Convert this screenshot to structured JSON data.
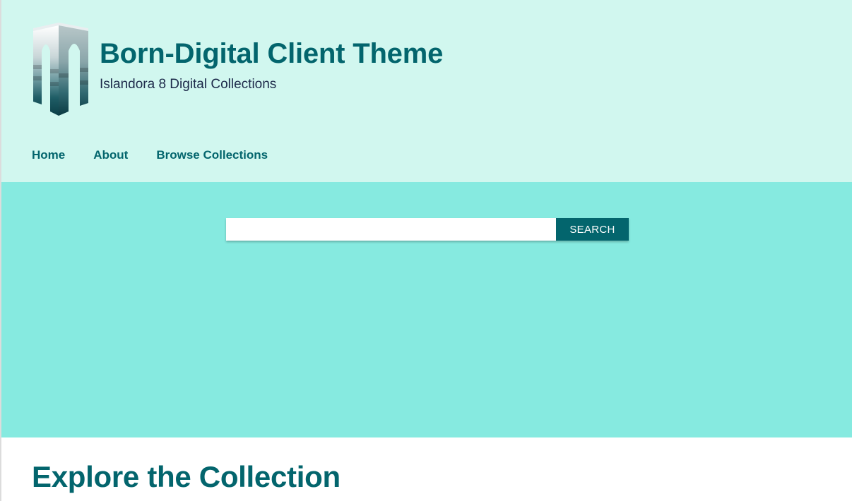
{
  "header": {
    "logo_icon": "islandora-arch-logo-icon",
    "site_title": "Born-Digital Client Theme",
    "site_slogan": "Islandora 8 Digital Collections"
  },
  "nav": {
    "items": [
      {
        "label": "Home"
      },
      {
        "label": "About"
      },
      {
        "label": "Browse Collections"
      }
    ]
  },
  "search": {
    "input_value": "",
    "placeholder": "",
    "button_label": "SEARCH"
  },
  "main": {
    "section_heading": "Explore the Collection"
  },
  "colors": {
    "header_bg": "#d1f7ef",
    "hero_bg": "#86eae0",
    "brand_teal": "#03656d",
    "slogan_text": "#1d2a4a"
  }
}
